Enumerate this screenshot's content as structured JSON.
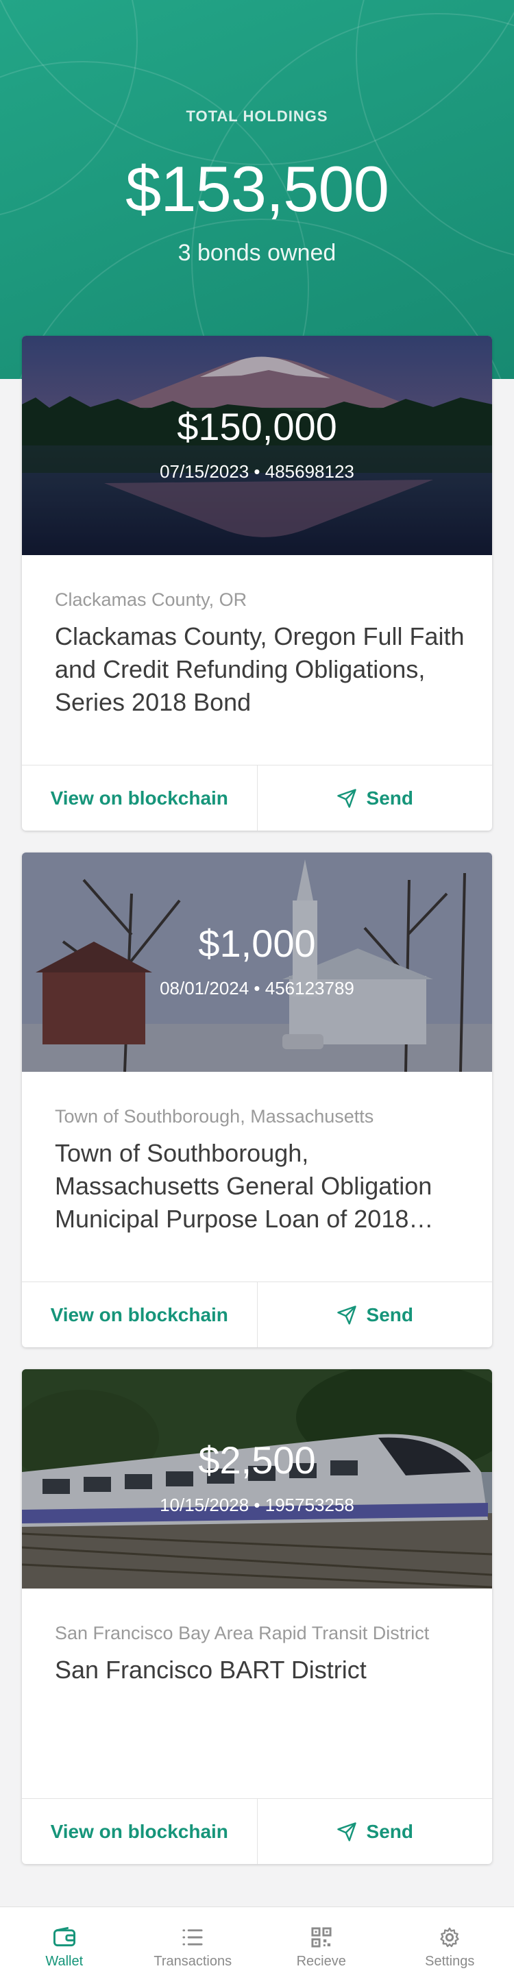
{
  "header": {
    "label": "TOTAL HOLDINGS",
    "total": "$153,500",
    "count_text": "3 bonds owned"
  },
  "bonds": [
    {
      "amount": "$150,000",
      "meta": "07/15/2023 • 485698123",
      "issuer": "Clackamas County, OR",
      "title": "Clackamas County, Oregon Full Faith and Credit Refunding Obligations, Series 2018 Bond",
      "image": "mountain-lake-photo"
    },
    {
      "amount": "$1,000",
      "meta": "08/01/2024 • 456123789",
      "issuer": "Town of Southborough, Massachusetts",
      "title": "Town of Southborough, Massachusetts General Obligation Municipal Purpose Loan of 2018…",
      "image": "church-town-photo"
    },
    {
      "amount": "$2,500",
      "meta": "10/15/2028 • 195753258",
      "issuer": "San Francisco Bay Area Rapid Transit District",
      "title": "San Francisco BART District",
      "image": "train-photo"
    }
  ],
  "actions": {
    "view_label": "View on blockchain",
    "send_label": "Send",
    "send_icon": "paper-plane-icon"
  },
  "tabs": [
    {
      "label": "Wallet",
      "icon": "wallet-icon",
      "active": true
    },
    {
      "label": "Transactions",
      "icon": "list-icon",
      "active": false
    },
    {
      "label": "Recieve",
      "icon": "qr-code-icon",
      "active": false
    },
    {
      "label": "Settings",
      "icon": "gear-icon",
      "active": false
    }
  ],
  "colors": {
    "accent": "#16957a",
    "hero": "#1e9c80",
    "background": "#f3f3f4"
  }
}
